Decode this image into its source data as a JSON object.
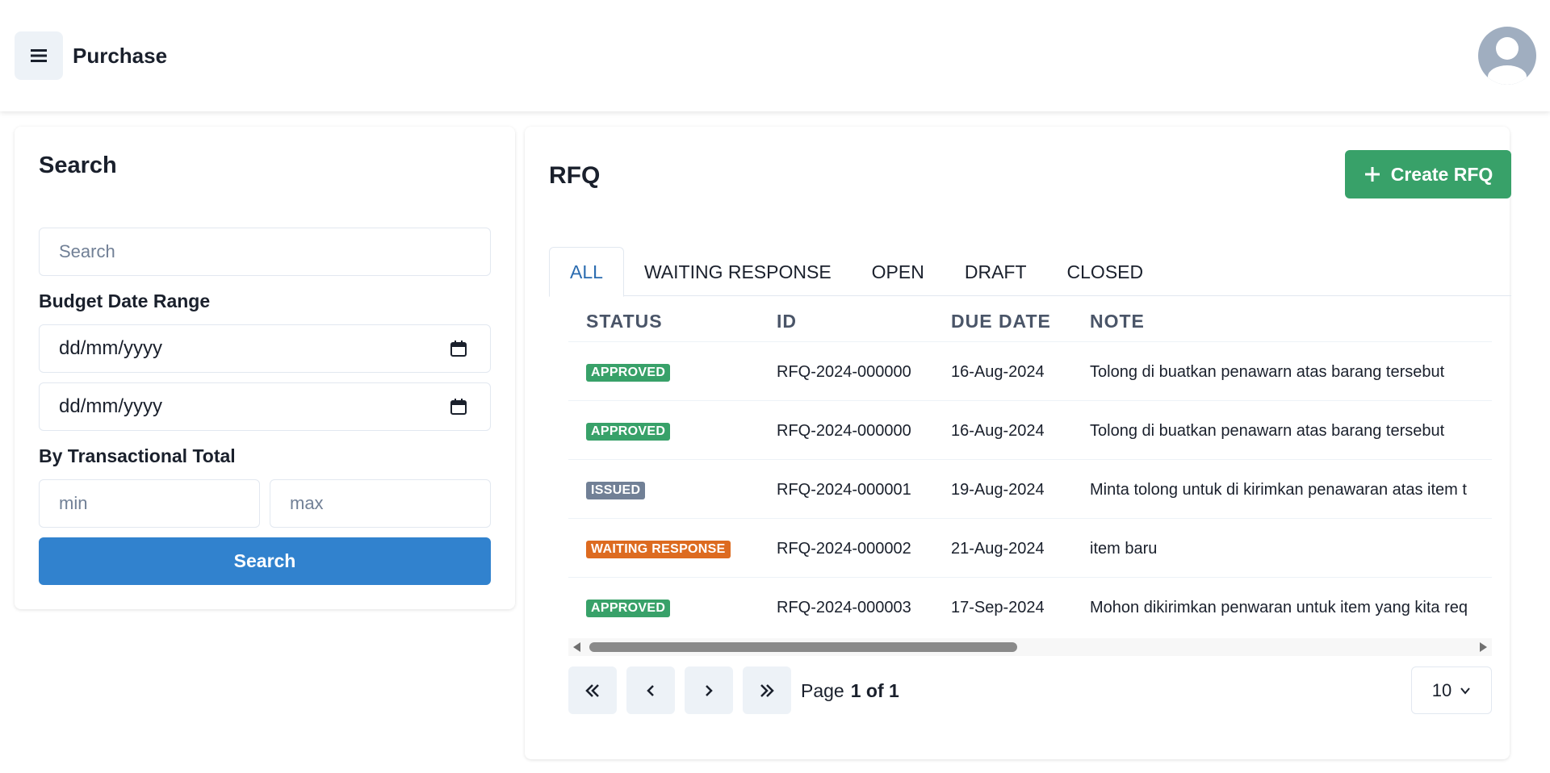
{
  "header": {
    "title": "Purchase",
    "menu_icon": "hamburger-icon",
    "avatar_icon": "user-avatar-icon"
  },
  "search_panel": {
    "title": "Search",
    "search_placeholder": "Search",
    "budget_label": "Budget Date Range",
    "date_from": "dd/mm/yyyy",
    "date_to": "dd/mm/yyyy",
    "total_label": "By Transactional Total",
    "min_placeholder": "min",
    "max_placeholder": "max",
    "search_button": "Search"
  },
  "rfq": {
    "title": "RFQ",
    "create_button": "Create RFQ",
    "tabs": [
      {
        "label": "ALL",
        "active": true
      },
      {
        "label": "WAITING RESPONSE",
        "active": false
      },
      {
        "label": "OPEN",
        "active": false
      },
      {
        "label": "DRAFT",
        "active": false
      },
      {
        "label": "CLOSED",
        "active": false
      }
    ],
    "columns": [
      "STATUS",
      "ID",
      "DUE DATE",
      "NOTE"
    ],
    "rows": [
      {
        "status": "APPROVED",
        "status_color": "#38a169",
        "id": "RFQ-2024-000000",
        "due_date": "16-Aug-2024",
        "note": "Tolong di buatkan penawarn atas barang tersebut"
      },
      {
        "status": "APPROVED",
        "status_color": "#38a169",
        "id": "RFQ-2024-000000",
        "due_date": "16-Aug-2024",
        "note": "Tolong di buatkan penawarn atas barang tersebut"
      },
      {
        "status": "ISSUED",
        "status_color": "#718096",
        "id": "RFQ-2024-000001",
        "due_date": "19-Aug-2024",
        "note": "Minta tolong untuk di kirimkan penawaran atas item t"
      },
      {
        "status": "WAITING RESPONSE",
        "status_color": "#dd6b20",
        "id": "RFQ-2024-000002",
        "due_date": "21-Aug-2024",
        "note": "item baru"
      },
      {
        "status": "APPROVED",
        "status_color": "#38a169",
        "id": "RFQ-2024-000003",
        "due_date": "17-Sep-2024",
        "note": "Mohon dikirimkan penwaran untuk item yang kita req"
      }
    ],
    "pagination": {
      "page_label": "Page",
      "page_value": "1 of 1",
      "per_page": "10"
    }
  },
  "colors": {
    "primary": "#3182ce",
    "success": "#38a169",
    "warning": "#dd6b20",
    "muted": "#718096"
  }
}
